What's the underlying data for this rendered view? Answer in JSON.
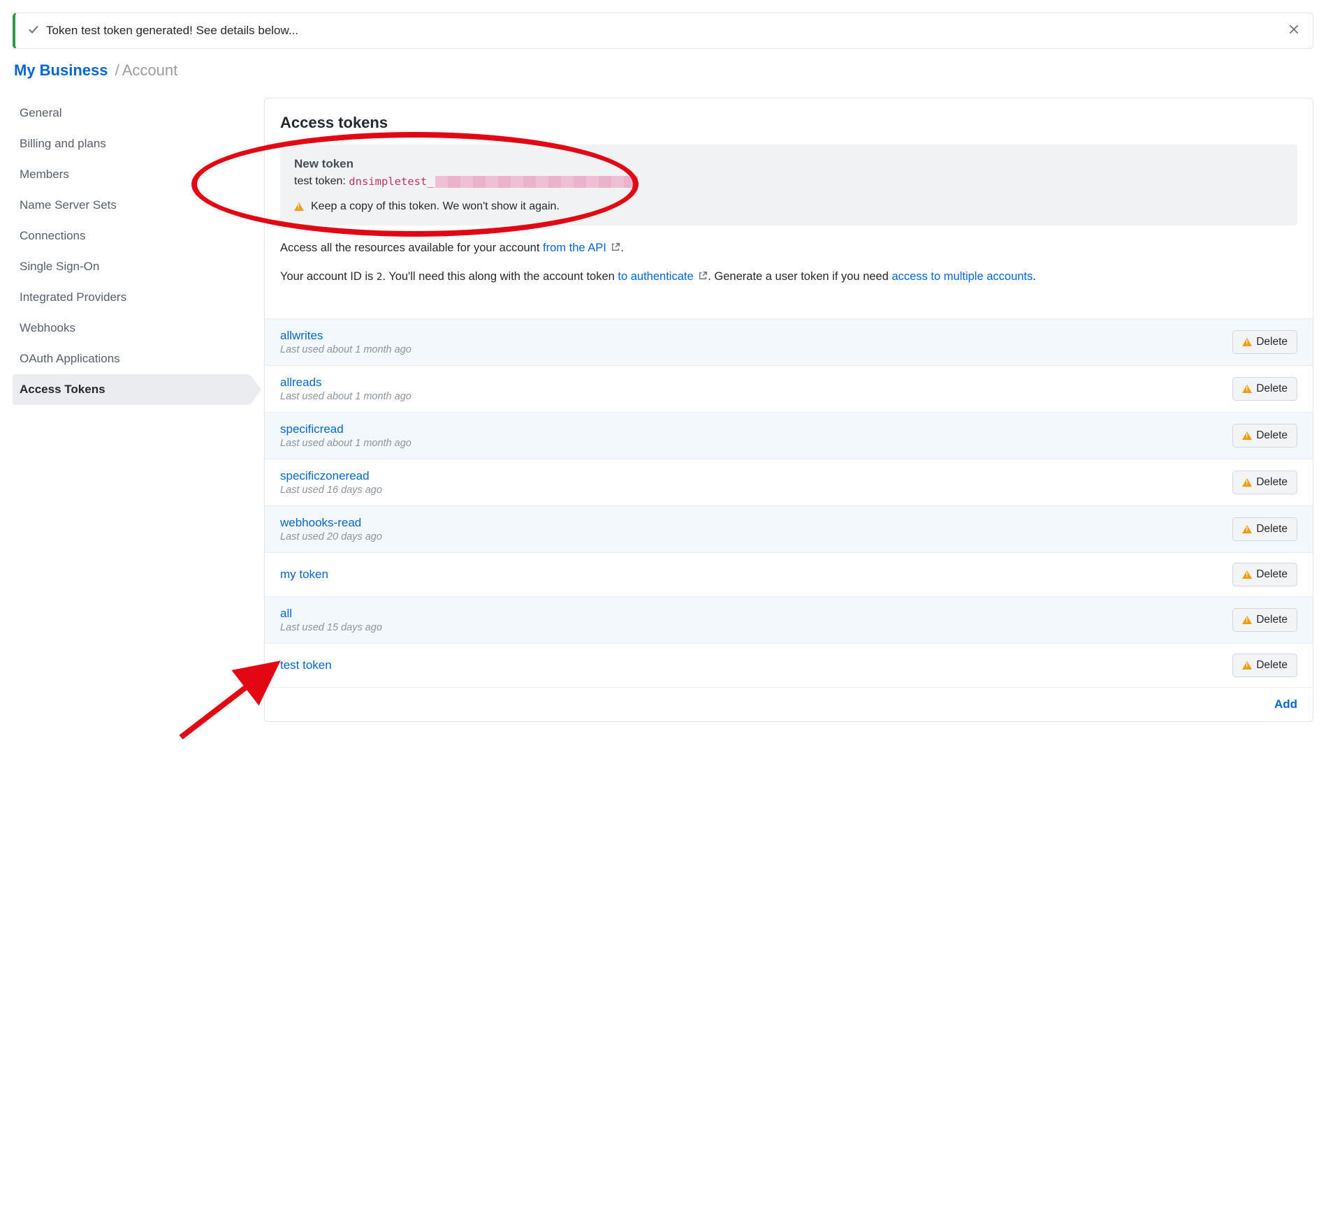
{
  "alert": {
    "text": "Token test token generated! See details below..."
  },
  "breadcrumb": {
    "root": "My Business",
    "sep": "/",
    "current": "Account"
  },
  "sidebar": {
    "items": [
      {
        "label": "General",
        "active": false
      },
      {
        "label": "Billing and plans",
        "active": false
      },
      {
        "label": "Members",
        "active": false
      },
      {
        "label": "Name Server Sets",
        "active": false
      },
      {
        "label": "Connections",
        "active": false
      },
      {
        "label": "Single Sign-On",
        "active": false
      },
      {
        "label": "Integrated Providers",
        "active": false
      },
      {
        "label": "Webhooks",
        "active": false
      },
      {
        "label": "OAuth Applications",
        "active": false
      },
      {
        "label": "Access Tokens",
        "active": true
      }
    ]
  },
  "main": {
    "heading": "Access tokens",
    "new_token": {
      "title": "New token",
      "label": "test token:",
      "secret_prefix": "dnsimpletest_",
      "warning": "Keep a copy of this token. We won't show it again."
    },
    "desc1_pre": "Access all the resources available for your account ",
    "desc1_link": "from the API",
    "desc1_post": ".",
    "desc2_pre": "Your account ID is ",
    "desc2_id": "2",
    "desc2_mid": ". You'll need this along with the account token ",
    "desc2_link1": "to authenticate",
    "desc2_mid2": ". Generate a user token if you need ",
    "desc2_link2": "access to multiple accounts",
    "desc2_post": ".",
    "tokens": [
      {
        "name": "allwrites",
        "meta": "Last used about 1 month ago"
      },
      {
        "name": "allreads",
        "meta": "Last used about 1 month ago"
      },
      {
        "name": "specificread",
        "meta": "Last used about 1 month ago"
      },
      {
        "name": "specificzoneread",
        "meta": "Last used 16 days ago"
      },
      {
        "name": "webhooks-read",
        "meta": "Last used 20 days ago"
      },
      {
        "name": "my token",
        "meta": ""
      },
      {
        "name": "all",
        "meta": "Last used 15 days ago"
      },
      {
        "name": "test token",
        "meta": ""
      }
    ],
    "delete_label": "Delete",
    "add_label": "Add"
  }
}
